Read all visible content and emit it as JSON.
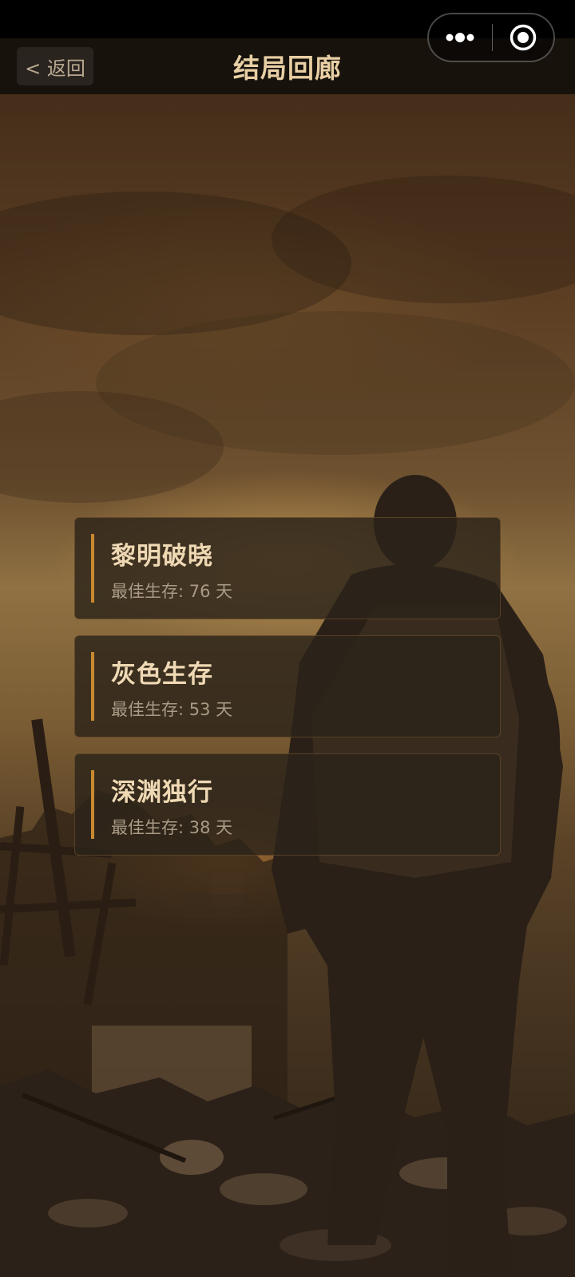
{
  "navbar": {
    "back_label": "< 返回",
    "title": "结局回廊"
  },
  "capsule": {
    "more_icon": "more-dots-icon",
    "close_icon": "target-circle-icon"
  },
  "endings": [
    {
      "title": "黎明破晓",
      "subtitle": "最佳生存: 76 天"
    },
    {
      "title": "灰色生存",
      "subtitle": "最佳生存: 53 天"
    },
    {
      "title": "深渊独行",
      "subtitle": "最佳生存: 38 天"
    }
  ],
  "colors": {
    "title_gold": "#e8cfa4",
    "accent": "#c98a2f",
    "card_bg": "#2c231a"
  }
}
